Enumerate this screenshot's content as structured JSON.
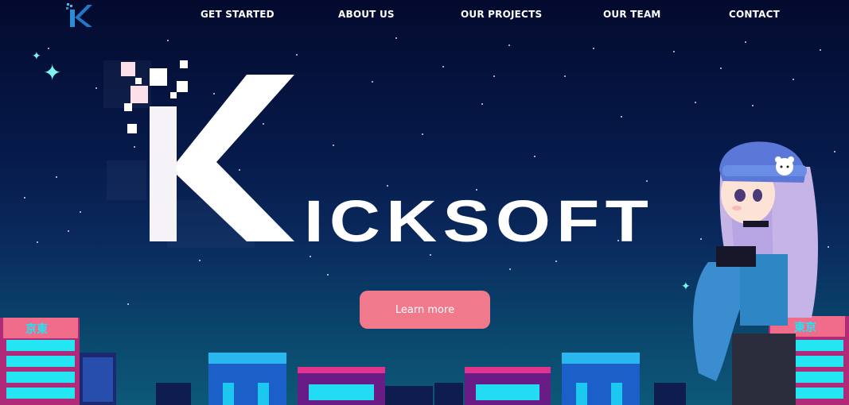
{
  "nav": {
    "brand_letter": "K",
    "links": [
      {
        "label": "GET STARTED"
      },
      {
        "label": "ABOUT US"
      },
      {
        "label": "OUR PROJECTS"
      },
      {
        "label": "OUR TEAM"
      },
      {
        "label": "CONTACT"
      }
    ]
  },
  "hero": {
    "logo_text": "KICKSOFT",
    "cta_label": "Learn more"
  },
  "signs": {
    "left": "京東",
    "right": "東京"
  },
  "colors": {
    "accent": "#f07a8c",
    "neon_cyan": "#1fe7f5",
    "neon_magenta": "#e0338e",
    "bg_top": "#030a2e",
    "bg_bottom": "#0d5878"
  },
  "icons": {
    "brand": "kicksoft-logo-icon",
    "sparkle": "sparkle-star-icon",
    "bear": "bear-badge-icon"
  }
}
